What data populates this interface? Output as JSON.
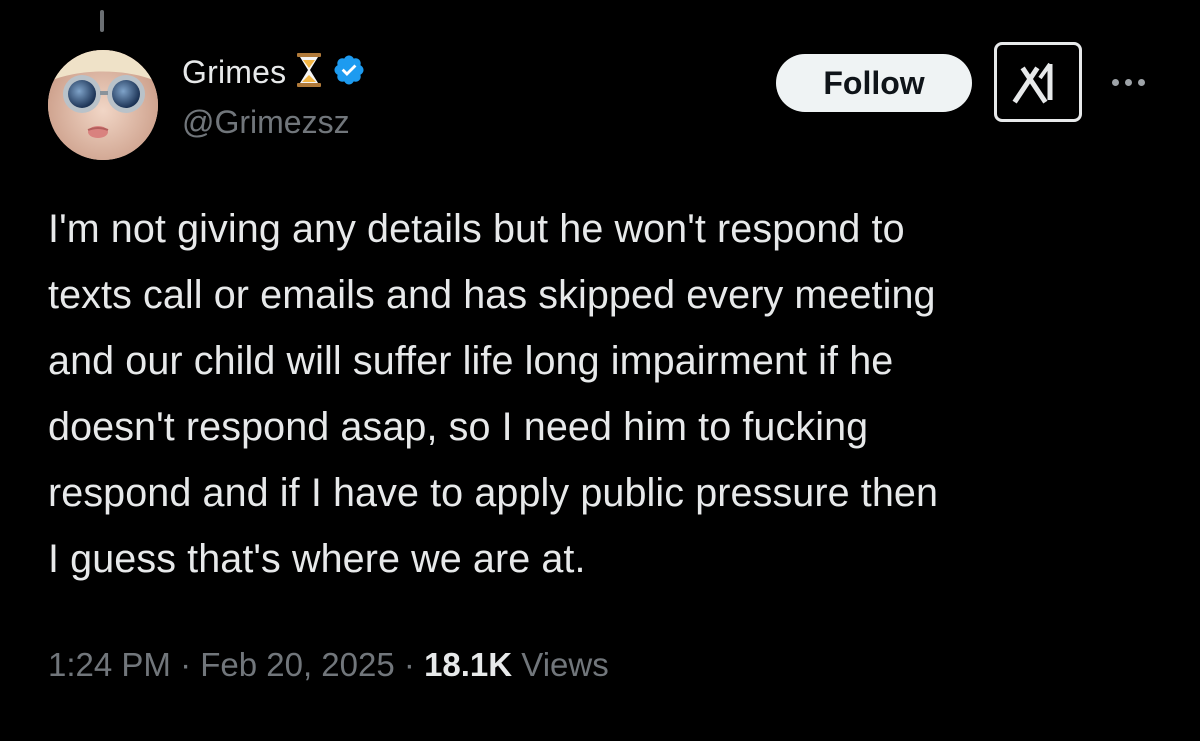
{
  "author": {
    "display_name": "Grimes",
    "handle": "@Grimezsz",
    "name_emoji": "hourglass-icon",
    "verified_badge": "verified-icon"
  },
  "actions": {
    "follow_label": "Follow",
    "grok_icon": "grok-icon",
    "more_icon": "more-icon"
  },
  "tweet": {
    "text": "I'm not giving any details but he won't respond to\ntexts call or emails and has skipped every meeting\nand our child will suffer life long impairment if he\ndoesn't respond asap, so I need him to fucking\nrespond and if I have to apply public pressure then\nI guess that's where we are at."
  },
  "meta": {
    "time": "1:24 PM",
    "separator": " · ",
    "date": "Feb 20, 2025",
    "views_count": "18.1K",
    "views_label": "Views"
  },
  "colors": {
    "background": "#000000",
    "text": "#e7e9ea",
    "secondary": "#71767b",
    "verified": "#1d9bf0",
    "follow_bg": "#eff3f4"
  }
}
